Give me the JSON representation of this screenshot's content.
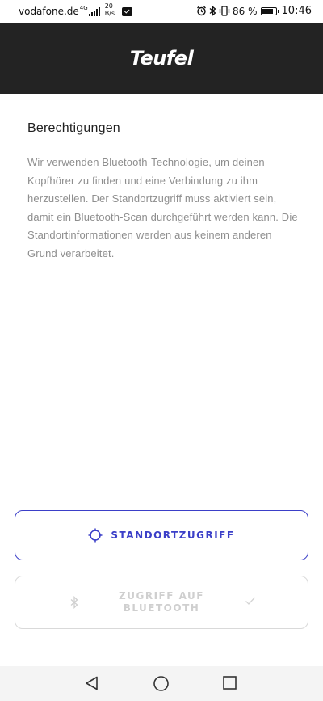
{
  "status_bar": {
    "carrier": "vodafone.de",
    "network": "4G",
    "speed_value": "20",
    "speed_unit": "B/s",
    "alarm_icon": "alarm-icon",
    "bluetooth_icon": "bluetooth-icon",
    "vibrate_icon": "vibrate-icon",
    "battery_percent": "86 %",
    "battery_level": 0.86,
    "time": "10:46"
  },
  "header": {
    "brand": "Teufel",
    "background_color": "#232323"
  },
  "main": {
    "title": "Berechtigungen",
    "description": "Wir verwenden Bluetooth-Technologie, um deinen Kopfhörer zu finden und eine Verbindung zu ihm herzustellen. Der Standortzugriff muss aktiviert sein, damit ein Bluetooth-Scan durchgeführt werden kann. Die Standortinformationen werden aus keinem anderen Grund verarbeitet."
  },
  "buttons": {
    "location": {
      "label": "STANDORTZUGRIFF",
      "icon": "location-target-icon",
      "accent_color": "#3b3fc8"
    },
    "bluetooth": {
      "label": "ZUGRIFF AUF BLUETOOTH",
      "icon": "bluetooth-icon",
      "status_icon": "check-icon",
      "enabled": false
    }
  },
  "nav_bar": {
    "back_icon": "back-triangle-icon",
    "home_icon": "home-circle-icon",
    "recent_icon": "recent-square-icon"
  }
}
